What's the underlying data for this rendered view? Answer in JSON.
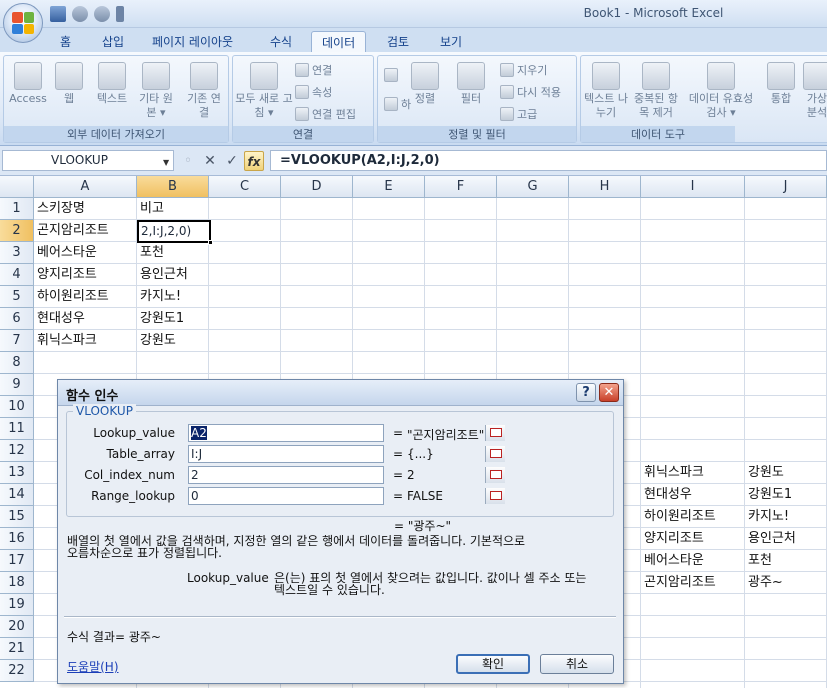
{
  "window": {
    "title": "Book1 - Microsoft Excel"
  },
  "ribbon": {
    "tabs": [
      "홈",
      "삽입",
      "페이지 레이아웃",
      "수식",
      "데이터",
      "검토",
      "보기"
    ],
    "active_tab": "데이터",
    "groups": {
      "external": {
        "label": "외부 데이터 가져오기",
        "buttons": [
          "Access",
          "웹",
          "텍스트",
          "기타 원본 ▾",
          "기존 연결"
        ]
      },
      "connections": {
        "label": "연결",
        "refresh_all": "모두 새로 고침 ▾",
        "connections": "연결",
        "properties": "속성",
        "edit_links": "연결 편집"
      },
      "sort_filter": {
        "label": "정렬 및 필터",
        "sort_az": "하",
        "sort": "정렬",
        "filter": "필터",
        "clear": "지우기",
        "reapply": "다시 적용",
        "advanced": "고급"
      },
      "data_tools": {
        "label": "데이터 도구",
        "text_to_columns": "텍스트 나누기",
        "remove_duplicates": "중복된 항목 제거",
        "validation": "데이터 유효성 검사 ▾",
        "consolidate": "통합",
        "whatif": "가상 분석"
      }
    }
  },
  "formula_bar": {
    "name_box": "VLOOKUP",
    "cancel": "✕",
    "enter": "✓",
    "fx": "fx",
    "formula": "=VLOOKUP(A2,I:J,2,0)"
  },
  "grid": {
    "columns": [
      "A",
      "B",
      "C",
      "D",
      "E",
      "F",
      "G",
      "H",
      "I",
      "J"
    ],
    "rows": [
      "1",
      "2",
      "3",
      "4",
      "5",
      "6",
      "7",
      "8",
      "9",
      "10",
      "11",
      "12",
      "13",
      "14",
      "15",
      "16",
      "17",
      "18",
      "19",
      "20",
      "21",
      "22"
    ],
    "col_a": [
      "스키장명",
      "곤지암리조트",
      "베어스타운",
      "양지리조트",
      "하이원리조트",
      "현대성우",
      "휘닉스파크"
    ],
    "col_b": [
      "비고",
      "",
      "포천",
      "용인근처",
      "카지노!",
      "강원도1",
      "강원도"
    ],
    "active_cell_text": "2,I:J,2,0)",
    "col_i": [
      "휘닉스파크",
      "현대성우",
      "하이원리조트",
      "양지리조트",
      "베어스타운",
      "곤지암리조트"
    ],
    "col_j": [
      "강원도",
      "강원도1",
      "카지노!",
      "용인근처",
      "포천",
      "광주~"
    ]
  },
  "dialog": {
    "title": "함수 인수",
    "help_btn": "?",
    "close_btn": "✕",
    "function_name": "VLOOKUP",
    "args": [
      {
        "label": "Lookup_value",
        "value": "A2",
        "result": "\"곤지암리조트\""
      },
      {
        "label": "Table_array",
        "value": "I:J",
        "result": "{...}"
      },
      {
        "label": "Col_index_num",
        "value": "2",
        "result": "2"
      },
      {
        "label": "Range_lookup",
        "value": "0",
        "result": "FALSE"
      }
    ],
    "eq": "=",
    "overall_result": "= \"광주~\"",
    "description_line1": "배열의 첫 열에서 값을 검색하며, 지정한 열의 같은 행에서 데이터를 돌려줍니다. 기본적으로",
    "description_line2": "오름차순으로 표가 정렬됩니다.",
    "arg_help_name": "Lookup_value",
    "arg_help_line1": "은(는) 표의 첫 열에서 찾으려는 값입니다. 값이나 셀 주소 또는",
    "arg_help_line2": "텍스트일 수 있습니다.",
    "formula_result": "수식 결과=  광주~",
    "help_link": "도움말(H)",
    "ok": "확인",
    "cancel": "취소"
  }
}
